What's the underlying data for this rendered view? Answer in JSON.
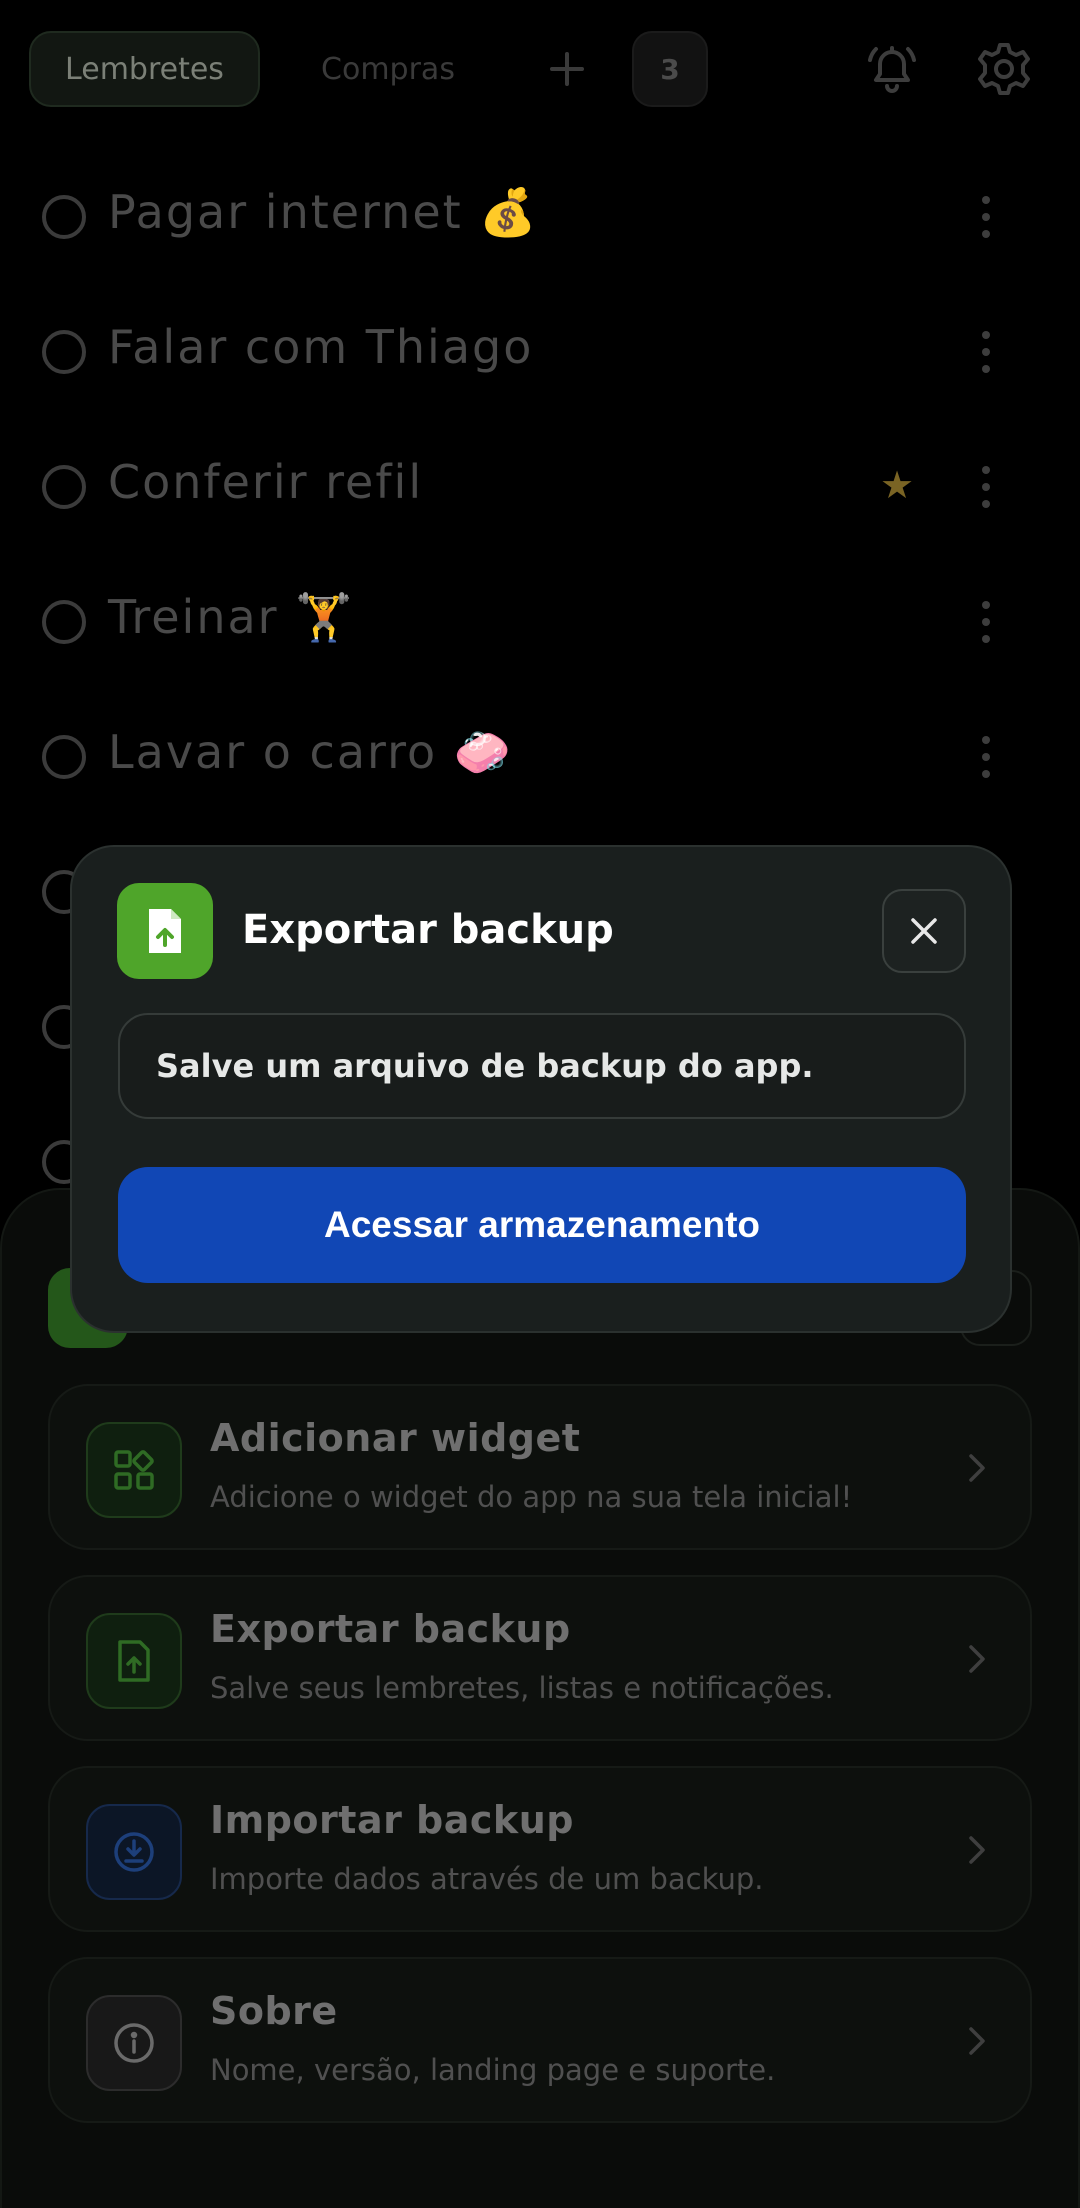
{
  "header": {
    "tabs": [
      {
        "label": "Lembretes",
        "active": true
      },
      {
        "label": "Compras",
        "active": false
      }
    ],
    "badge_count": "3",
    "icons": {
      "add": "plus-icon",
      "alerts": "bell-icon",
      "settings": "gear-icon"
    }
  },
  "reminders": [
    {
      "text": "Pagar internet 💰",
      "starred": false
    },
    {
      "text": "Falar com Thiago",
      "starred": false
    },
    {
      "text": "Conferir refil",
      "starred": true
    },
    {
      "text": "Treinar 🏋️",
      "starred": false
    },
    {
      "text": "Lavar o carro 🧼",
      "starred": false
    }
  ],
  "settings_sheet": {
    "cards": [
      {
        "title": "Adicionar widget",
        "subtitle": "Adicione o widget do app na sua tela inicial!",
        "icon": "widget-icon",
        "accent": "#2f6b24"
      },
      {
        "title": "Exportar backup",
        "subtitle": "Salve seus lembretes, listas e notificações.",
        "icon": "file-export-icon",
        "accent": "#2f6b24"
      },
      {
        "title": "Importar backup",
        "subtitle": "Importe dados através de um backup.",
        "icon": "download-icon",
        "accent": "#1d3f7a"
      },
      {
        "title": "Sobre",
        "subtitle": "Nome, versão, landing page e suporte.",
        "icon": "info-icon",
        "accent": "#6a6a6a"
      }
    ]
  },
  "dialog": {
    "title": "Exportar backup",
    "message": "Salve um arquivo de backup do app.",
    "button_label": "Acessar armazenamento",
    "icon": "file-upload-icon",
    "close_icon": "close-icon",
    "colors": {
      "icon_bg": "#4fa52a",
      "button_bg": "#1147b5",
      "surface": "#1a1f1e"
    }
  }
}
